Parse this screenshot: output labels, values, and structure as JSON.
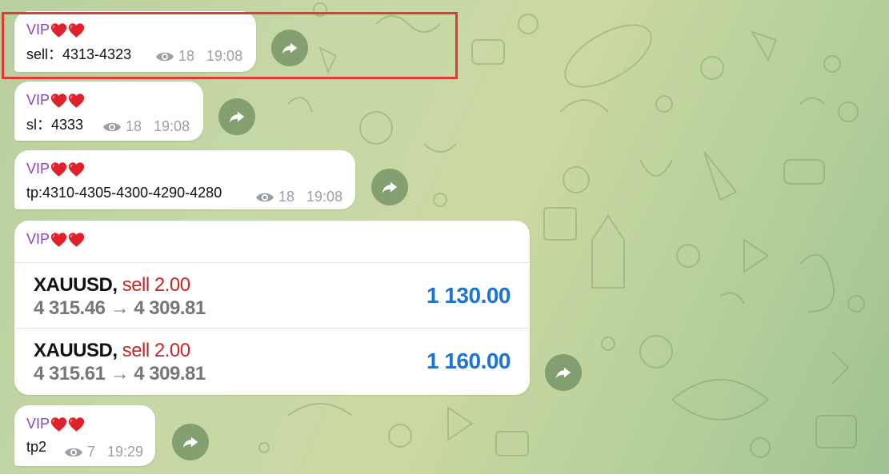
{
  "colors": {
    "sender": "#8a45c7",
    "sell": "#c62828",
    "profit": "#1e74d2",
    "highlight": "#e53935"
  },
  "messages": [
    {
      "sender": "VIP",
      "text": "sell：4313-4323",
      "views": "18",
      "time": "19:08"
    },
    {
      "sender": "VIP",
      "text": "sl：4333",
      "views": "18",
      "time": "19:08"
    },
    {
      "sender": "VIP",
      "text": "tp:4310-4305-4300-4290-4280",
      "views": "18",
      "time": "19:08"
    },
    {
      "sender": "VIP",
      "trades": [
        {
          "symbol": "XAUUSD,",
          "side": "sell 2.00",
          "prices": "4 315.46 → 4 309.81",
          "profit": "1 130.00"
        },
        {
          "symbol": "XAUUSD,",
          "side": "sell 2.00",
          "prices": "4 315.61 → 4 309.81",
          "profit": "1 160.00"
        }
      ]
    },
    {
      "sender": "VIP",
      "text": "tp2",
      "views": "7",
      "time": "19:29"
    }
  ],
  "icons": {
    "views": "eye-icon",
    "forward": "forward-arrow-icon",
    "hearts": "red-heart-emoji"
  }
}
